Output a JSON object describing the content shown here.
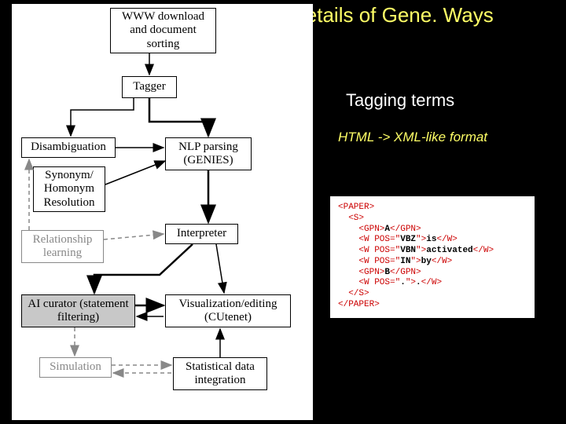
{
  "title": "Details of Gene. Ways",
  "subtitle": "Tagging terms",
  "subtitle2": "HTML -> XML-like format",
  "boxes": {
    "www": "WWW download\nand document\nsorting",
    "tagger": "Tagger",
    "disambig": "Disambiguation",
    "nlp": "NLP parsing\n(GENIES)",
    "syn": "Synonym/\nHomonym\nResolution",
    "interp": "Interpreter",
    "rel": "Relationship\nlearning",
    "ai": "AI curator\n(statement filtering)",
    "viz": "Visualization/editing\n(CUtenet)",
    "sim": "Simulation",
    "stat": "Statistical data\nintegration"
  },
  "code": {
    "l1a": "<PAPER>",
    "l2a": "<S>",
    "l3a": "<GPN>",
    "l3b": "A",
    "l3c": "</GPN>",
    "l4a": "<W POS=\"",
    "l4b": "VBZ",
    "l4c": "\">",
    "l4d": "is",
    "l4e": "</W>",
    "l5a": "<W POS=\"",
    "l5b": "VBN",
    "l5c": "\">",
    "l5d": "activated",
    "l5e": "</W>",
    "l6a": "<W POS=\"",
    "l6b": "IN",
    "l6c": "\">",
    "l6d": "by",
    "l6e": "</W>",
    "l7a": "<GPN>",
    "l7b": "B",
    "l7c": "</GPN>",
    "l8a": "<W POS=\"",
    "l8b": ".",
    "l8c": "\">",
    "l8d": ".",
    "l8e": "</W>",
    "l9a": "</S>",
    "l10a": "</PAPER>"
  }
}
